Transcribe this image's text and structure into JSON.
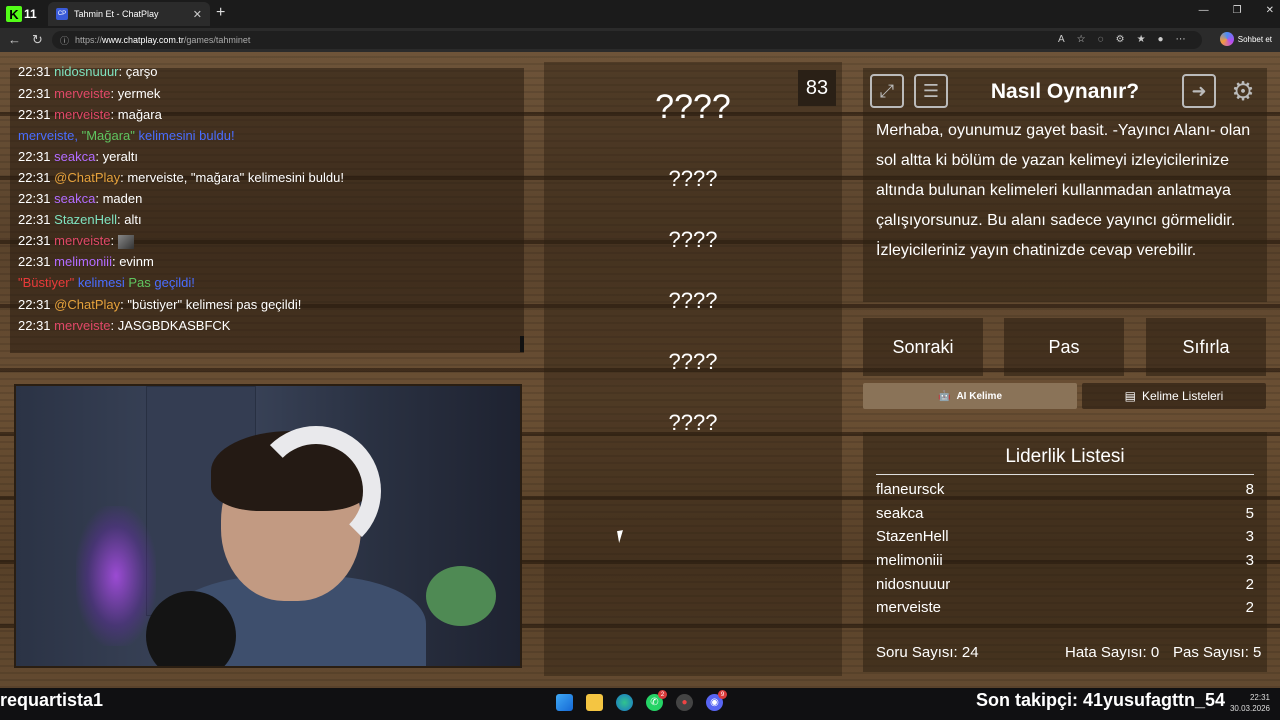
{
  "browser": {
    "app_logo_number": "11",
    "tab_title": "Tahmin Et - ChatPlay",
    "tab_favicon": "CP",
    "url_prefix": "https://",
    "url_host": "www.chatplay.com.tr",
    "url_path": "/games/tahminet",
    "copilot_label": "Sohbet et"
  },
  "chat": {
    "messages": [
      {
        "time": "22:31",
        "user": "nidosnuuur",
        "text": ": çarşo"
      },
      {
        "time": "22:31",
        "user": "merveiste",
        "text": ": yermek"
      },
      {
        "time": "22:31",
        "user": "merveiste",
        "text": ": mağara"
      },
      {
        "system": "merveiste, \"Mağara\" kelimesini buldu!"
      },
      {
        "time": "22:31",
        "user": "seakca",
        "text": ": yeraltı"
      },
      {
        "time": "22:31",
        "user": "@ChatPlay",
        "text": ": merveiste, \"mağara\" kelimesini buldu!"
      },
      {
        "time": "22:31",
        "user": "seakca",
        "text": ": maden"
      },
      {
        "time": "22:31",
        "user": "StazenHell",
        "text": ": altı"
      },
      {
        "time": "22:31",
        "user": "merveiste",
        "text": ":"
      },
      {
        "time": "22:31",
        "user": "melimoniii",
        "text": ": evinm"
      },
      {
        "system": "\"Büstiyer\" kelimesi Pas geçildi!"
      },
      {
        "time": "22:31",
        "user": "@ChatPlay",
        "text": ": \"büstiyer\" kelimesi pas geçildi!"
      },
      {
        "time": "22:31",
        "user": "merveiste",
        "text": ": JASGBDKASBFCK"
      }
    ],
    "system_1": {
      "name": "merveiste, ",
      "word": "\"Mağara\"",
      "rest": " kelimesini buldu!"
    },
    "system_2": {
      "word": "\"Büstiyer\"",
      "mid": " kelimesi ",
      "pas": "Pas",
      "rest": " geçildi!"
    }
  },
  "game": {
    "score": "83",
    "main_word": "????",
    "words": [
      "????",
      "????",
      "????",
      "????",
      "????"
    ]
  },
  "howto": {
    "title": "Nasıl Oynanır?",
    "body": "Merhaba, oyunumuz gayet basit. -Yayıncı Alanı- olan sol altta ki bölüm de yazan kelimeyi izleyicilerinize altında bulunan kelimeleri kullanmadan anlatmaya çalışıyorsunuz. Bu alanı sadece yayıncı görmelidir. İzleyicileriniz yayın chatinizde cevap verebilir."
  },
  "controls": {
    "next": "Sonraki",
    "pass": "Pas",
    "reset": "Sıfırla",
    "ai_word": "AI Kelime",
    "word_lists": "Kelime Listeleri"
  },
  "leaderboard": {
    "title": "Liderlik Listesi",
    "rows": [
      {
        "name": "flaneursck",
        "score": "8"
      },
      {
        "name": "seakca",
        "score": "5"
      },
      {
        "name": "StazenHell",
        "score": "3"
      },
      {
        "name": "melimoniii",
        "score": "3"
      },
      {
        "name": "nidosnuuur",
        "score": "2"
      },
      {
        "name": "merveiste",
        "score": "2"
      }
    ],
    "question_count": "Soru Sayısı: 24",
    "error_count": "Hata Sayısı: 0",
    "pass_count": "Pas Sayısı: 5"
  },
  "overlay": {
    "streamer": "requartista1",
    "last_follower": "Son takipçi: 41yusufagttn_54"
  },
  "taskbar": {
    "time": "22:31",
    "date": "30.03.2026",
    "whatsapp_badge": "2",
    "discord_badge": "9"
  }
}
